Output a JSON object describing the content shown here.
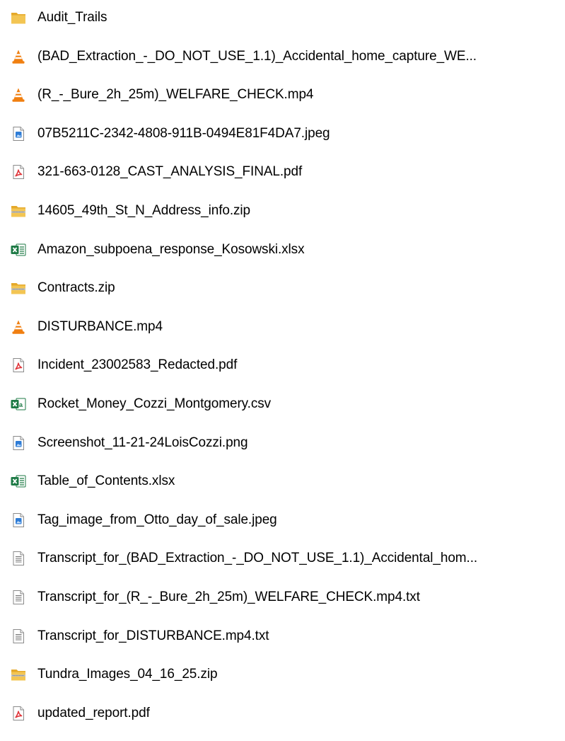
{
  "files": [
    {
      "name": "Audit_Trails",
      "icon": "folder-icon"
    },
    {
      "name": "(BAD_Extraction_-_DO_NOT_USE_1.1)_Accidental_home_capture_WE...",
      "icon": "vlc-media-icon"
    },
    {
      "name": "(R_-_Bure_2h_25m)_WELFARE_CHECK.mp4",
      "icon": "vlc-media-icon"
    },
    {
      "name": "07B5211C-2342-4808-911B-0494E81F4DA7.jpeg",
      "icon": "image-file-icon"
    },
    {
      "name": "321-663-0128_CAST_ANALYSIS_FINAL.pdf",
      "icon": "pdf-file-icon"
    },
    {
      "name": "14605_49th_St_N_Address_info.zip",
      "icon": "zip-folder-icon"
    },
    {
      "name": "Amazon_subpoena_response_Kosowski.xlsx",
      "icon": "excel-file-icon"
    },
    {
      "name": "Contracts.zip",
      "icon": "zip-folder-icon"
    },
    {
      "name": "DISTURBANCE.mp4",
      "icon": "vlc-media-icon"
    },
    {
      "name": "Incident_23002583_Redacted.pdf",
      "icon": "pdf-file-icon"
    },
    {
      "name": "Rocket_Money_Cozzi_Montgomery.csv",
      "icon": "csv-file-icon"
    },
    {
      "name": "Screenshot_11-21-24LoisCozzi.png",
      "icon": "image-file-icon"
    },
    {
      "name": "Table_of_Contents.xlsx",
      "icon": "excel-file-icon"
    },
    {
      "name": "Tag_image_from_Otto_day_of_sale.jpeg",
      "icon": "image-file-icon"
    },
    {
      "name": "Transcript_for_(BAD_Extraction_-_DO_NOT_USE_1.1)_Accidental_hom...",
      "icon": "text-file-icon"
    },
    {
      "name": "Transcript_for_(R_-_Bure_2h_25m)_WELFARE_CHECK.mp4.txt",
      "icon": "text-file-icon"
    },
    {
      "name": "Transcript_for_DISTURBANCE.mp4.txt",
      "icon": "text-file-icon"
    },
    {
      "name": "Tundra_Images_04_16_25.zip",
      "icon": "zip-folder-icon"
    },
    {
      "name": "updated_report.pdf",
      "icon": "pdf-file-icon"
    }
  ],
  "colors": {
    "folder": "#f3c553",
    "folder_dark": "#e5a92a",
    "vlc_orange": "#f07f10",
    "pdf_red": "#e0363b",
    "excel_green": "#1d7a45",
    "image_blue": "#2e7cd6",
    "text_gray": "#6f6f6f"
  }
}
